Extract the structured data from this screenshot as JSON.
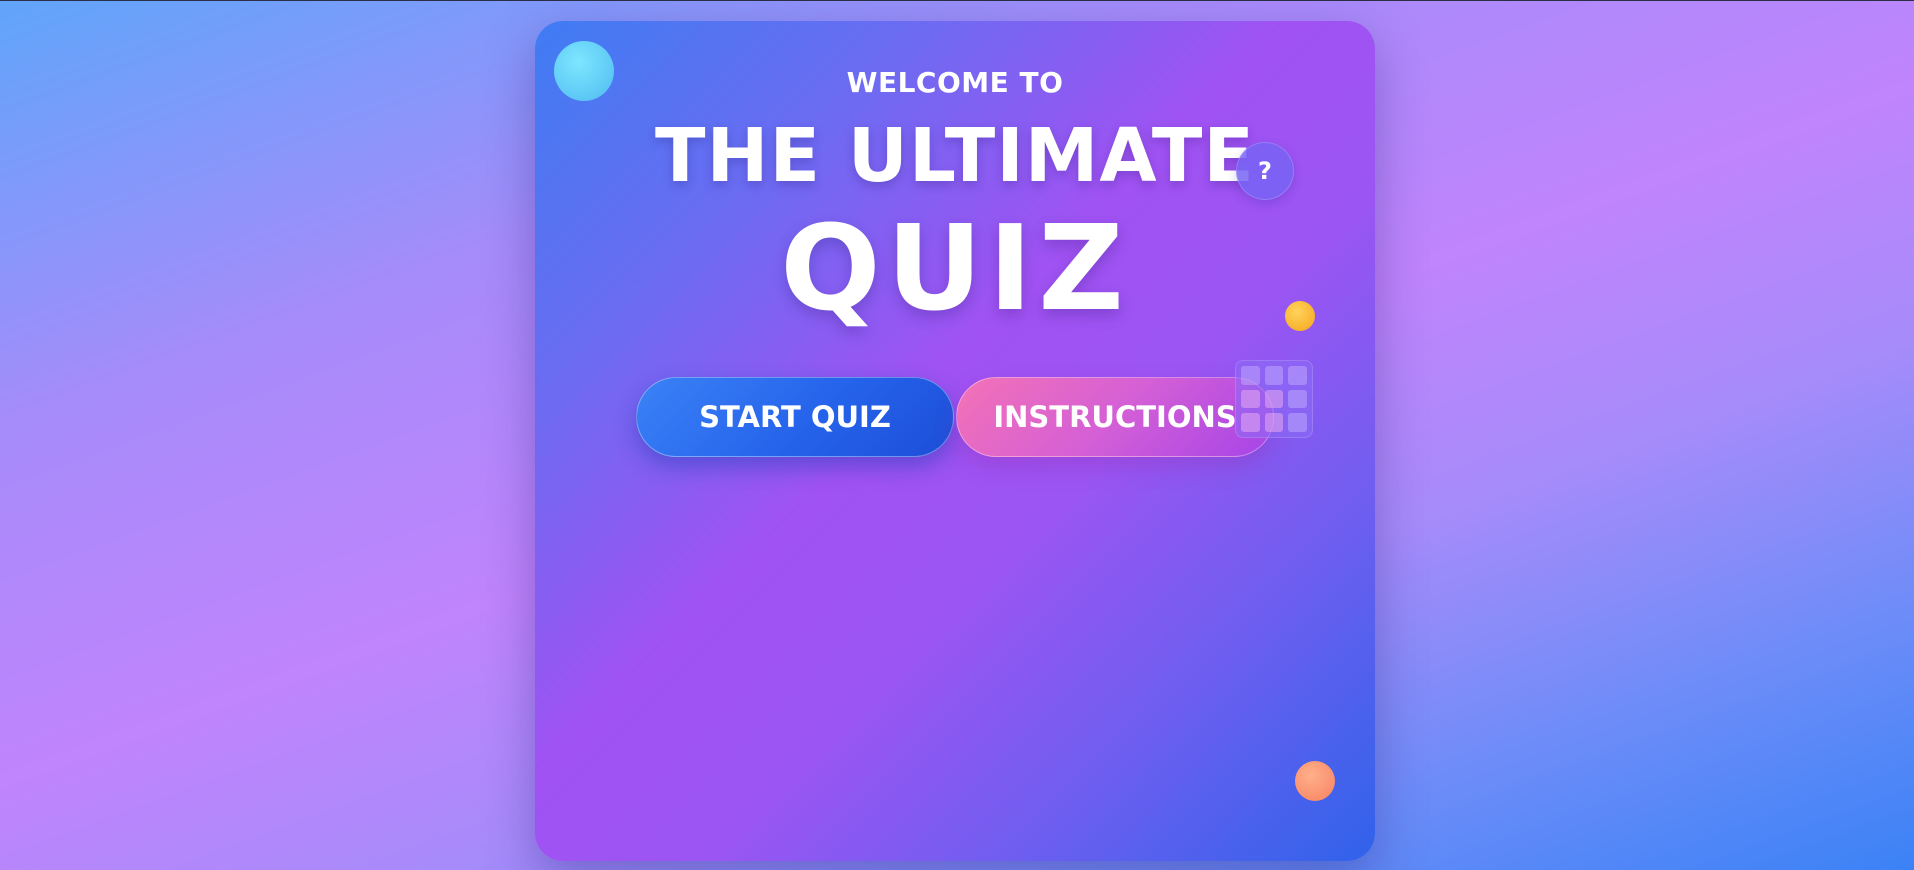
{
  "header": {
    "welcome": "WELCOME TO",
    "title_line1": "THE ULTIMATE",
    "title_line2": "QUIZ"
  },
  "actions": {
    "start_label": "START QUIZ",
    "instructions_label": "INSTRUCTIONS"
  },
  "decorations": {
    "help_badge": "?",
    "icons": [
      "circle-decoration",
      "question-mark-icon",
      "dot-decoration",
      "grid-icon",
      "dot-decoration"
    ]
  },
  "colors": {
    "start_button": "#2563eb",
    "instructions_button": "#d45fd6",
    "accent_yellow": "#f8b02b",
    "accent_orange": "#f98c6a",
    "accent_cyan": "#5dc8f5"
  }
}
